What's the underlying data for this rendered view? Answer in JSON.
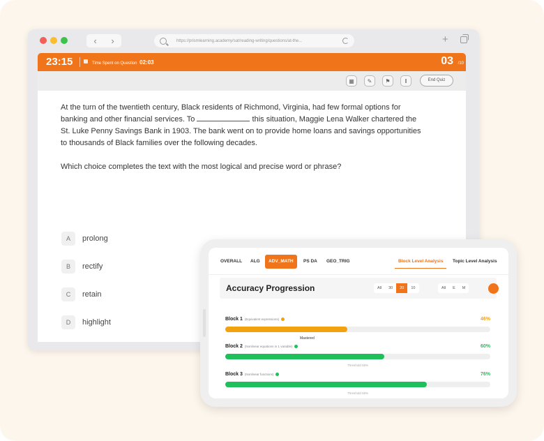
{
  "browser": {
    "url": "https://prismlearning.academy/sat/reading-writing/questions/at-the...",
    "nav_back": "‹",
    "nav_forward": "›",
    "new_tab": "+"
  },
  "quiz": {
    "timer": "23:15",
    "time_spent_label": "Time Spent on Question",
    "time_spent_value": "02:03",
    "question_number": "03",
    "question_total": "/10",
    "end_quiz_label": "End Quiz",
    "passage": [
      "At the turn of the twentieth century, Black residents of Richmond, Virginia, had few formal options for",
      "banking and other financial services. To",
      "this situation, Maggie Lena Walker chartered the",
      "St. Luke Penny Savings Bank in 1903. The bank went on to provide home loans and savings opportunities",
      "to thousands of Black families over the following decades."
    ],
    "prompt": "Which choice completes the text with the most logical and precise word or phrase?",
    "choices": [
      {
        "letter": "A",
        "text": "prolong"
      },
      {
        "letter": "B",
        "text": "rectify"
      },
      {
        "letter": "C",
        "text": "retain"
      },
      {
        "letter": "D",
        "text": "highlight"
      }
    ]
  },
  "analysis": {
    "tabs": [
      "OVERALL",
      "ALG",
      "ADV_MATH",
      "PS DA",
      "GEO_TRIG"
    ],
    "active_tab": "ADV_MATH",
    "views": [
      "Block Level Analysis",
      "Topic Level Analysis"
    ],
    "title": "Accuracy Progression",
    "range_options": [
      "All",
      "30",
      "20",
      "10"
    ],
    "active_range": "20",
    "difficulty_options": [
      "All",
      "E",
      "M"
    ],
    "blocks": [
      {
        "name": "Block 1",
        "topic": "(Equivalent expressions)",
        "percent": "46%",
        "value": 46,
        "color": "#f2a20f",
        "status_color": "#f2a20f"
      },
      {
        "name": "Block 2",
        "topic": "(Nonlinear equations in 1 variable)",
        "percent": "60%",
        "value": 60,
        "color": "#1fbf5c",
        "status_color": "#1fbf5c",
        "badge": "Mastered",
        "threshold": "Threshold 55%"
      },
      {
        "name": "Block 3",
        "topic": "(Nonlinear functions)",
        "percent": "76%",
        "value": 76,
        "color": "#1fbf5c",
        "status_color": "#1fbf5c",
        "threshold": "Threshold 55%"
      }
    ]
  },
  "colors": {
    "accent": "#f07419",
    "progress_orange": "#f2a20f",
    "progress_green": "#1fbf5c"
  }
}
